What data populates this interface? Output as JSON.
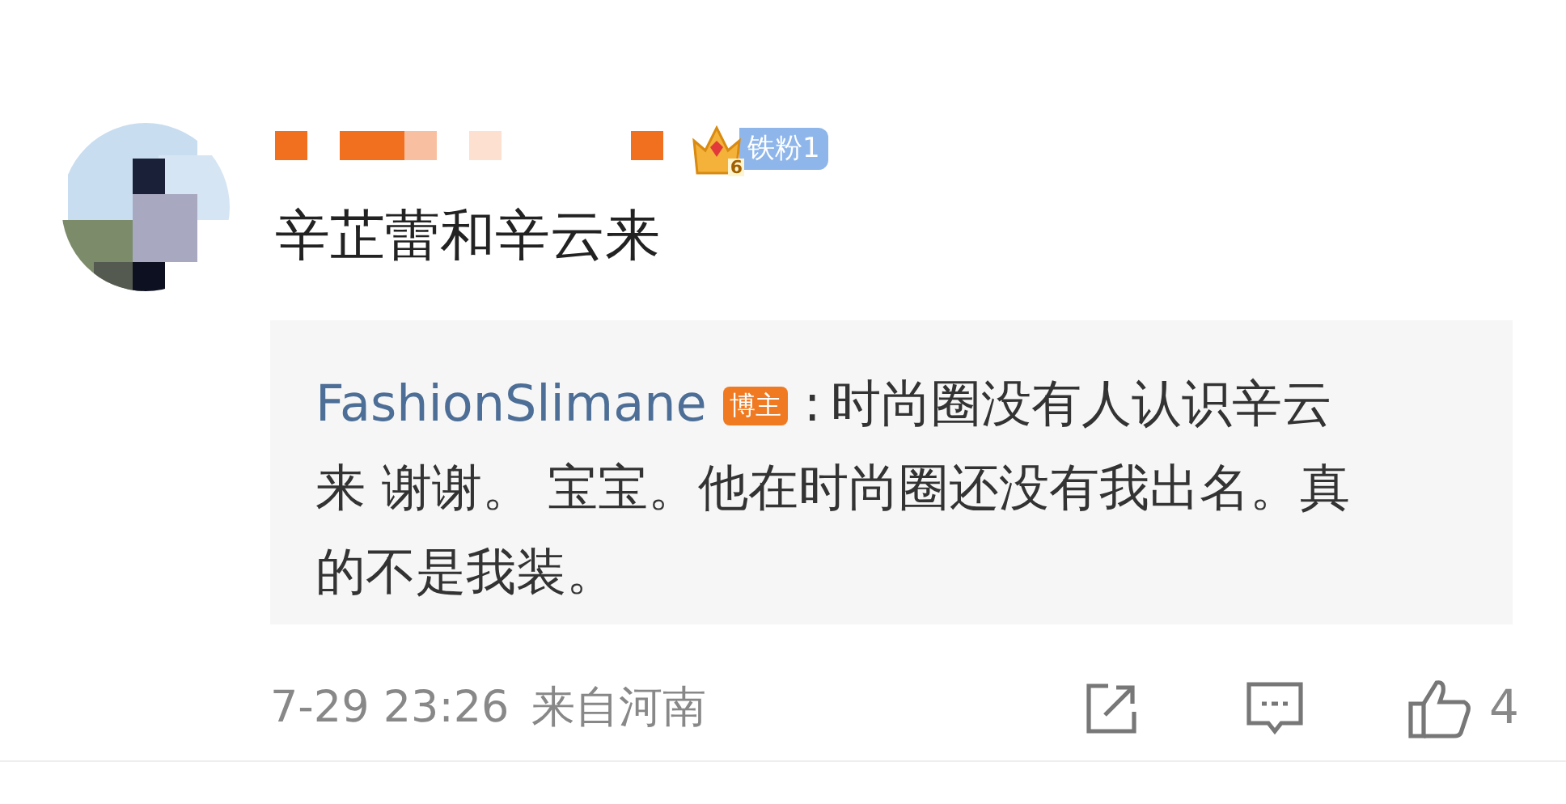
{
  "comment": {
    "fan_badge": {
      "level": "6",
      "label": "铁粉1"
    },
    "text": "辛芷蕾和辛云来",
    "reply": {
      "author": "FashionSlimane",
      "author_badge": "博主",
      "separator": ":",
      "text": "时尚圈没有人认识辛云来 谢谢。 宝宝。他在时尚圈还没有我出名。真的不是我装。"
    },
    "timestamp": "7-29 23:26",
    "location": "来自河南",
    "like_count": "4"
  }
}
